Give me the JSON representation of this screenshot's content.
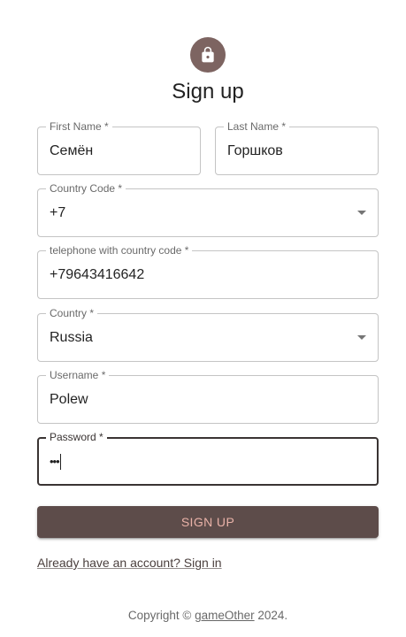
{
  "header": {
    "icon": "lock-icon",
    "title": "Sign up"
  },
  "form": {
    "first_name": {
      "label": "First Name",
      "required_mark": "*",
      "value": "Семён"
    },
    "last_name": {
      "label": "Last Name",
      "required_mark": "*",
      "value": "Горшков"
    },
    "country_code": {
      "label": "Country Code",
      "required_mark": "*",
      "value": "+7"
    },
    "telephone": {
      "label": "telephone with country code",
      "required_mark": "*",
      "value": "+79643416642"
    },
    "country": {
      "label": "Country",
      "required_mark": "*",
      "value": "Russia"
    },
    "username": {
      "label": "Username",
      "required_mark": "*",
      "value": "Polew"
    },
    "password": {
      "label": "Password",
      "required_mark": "*",
      "value": "•••"
    }
  },
  "actions": {
    "signup_label": "SIGN UP",
    "signin_link": "Already have an account? Sign in"
  },
  "footer": {
    "prefix": "Copyright © ",
    "link": "gameOther",
    "suffix": " 2024."
  },
  "colors": {
    "avatar_bg": "#7d6461",
    "button_bg": "#5d4c4a",
    "button_text": "#e9b2a8"
  }
}
